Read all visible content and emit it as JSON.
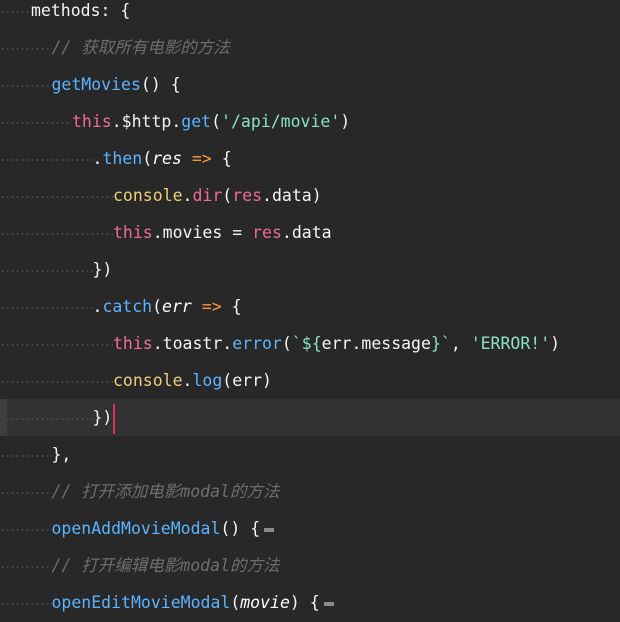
{
  "editor": {
    "lines": [
      {
        "indent": 0,
        "tokens": [
          {
            "t": "methods",
            "c": "k-white"
          },
          {
            "t": ": {",
            "c": "k-op"
          }
        ]
      },
      {
        "indent": 1,
        "tokens": [
          {
            "t": "// 获取所有电影的方法",
            "c": "k-comment"
          }
        ]
      },
      {
        "indent": 1,
        "tokens": [
          {
            "t": "getMovies",
            "c": "k-fn"
          },
          {
            "t": "() {",
            "c": "k-op"
          }
        ]
      },
      {
        "indent": 2,
        "tokens": [
          {
            "t": "this",
            "c": "k-kw"
          },
          {
            "t": ".$http.",
            "c": "k-op"
          },
          {
            "t": "get",
            "c": "k-fn"
          },
          {
            "t": "(",
            "c": "k-op"
          },
          {
            "t": "'/api/movie'",
            "c": "k-str"
          },
          {
            "t": ")",
            "c": "k-op"
          }
        ]
      },
      {
        "indent": 3,
        "tokens": [
          {
            "t": ".",
            "c": "k-op"
          },
          {
            "t": "then",
            "c": "k-fn"
          },
          {
            "t": "(",
            "c": "k-op"
          },
          {
            "t": "res",
            "c": "k-param"
          },
          {
            "t": " => ",
            "c": "k-arrow"
          },
          {
            "t": "{",
            "c": "k-op"
          }
        ]
      },
      {
        "indent": 4,
        "tokens": [
          {
            "t": "console",
            "c": "k-var"
          },
          {
            "t": ".",
            "c": "k-op"
          },
          {
            "t": "dir",
            "c": "k-kw"
          },
          {
            "t": "(",
            "c": "k-op"
          },
          {
            "t": "res",
            "c": "k-kw"
          },
          {
            "t": ".data)",
            "c": "k-op"
          }
        ]
      },
      {
        "indent": 4,
        "tokens": [
          {
            "t": "this",
            "c": "k-kw"
          },
          {
            "t": ".movies = ",
            "c": "k-op"
          },
          {
            "t": "res",
            "c": "k-kw"
          },
          {
            "t": ".data",
            "c": "k-op"
          }
        ]
      },
      {
        "indent": 3,
        "tokens": [
          {
            "t": "})",
            "c": "k-op"
          }
        ]
      },
      {
        "indent": 3,
        "tokens": [
          {
            "t": ".",
            "c": "k-op"
          },
          {
            "t": "catch",
            "c": "k-fn"
          },
          {
            "t": "(",
            "c": "k-op"
          },
          {
            "t": "err",
            "c": "k-param"
          },
          {
            "t": " => ",
            "c": "k-arrow"
          },
          {
            "t": "{",
            "c": "k-op"
          }
        ]
      },
      {
        "indent": 4,
        "tokens": [
          {
            "t": "this",
            "c": "k-kw"
          },
          {
            "t": ".toastr.",
            "c": "k-op"
          },
          {
            "t": "error",
            "c": "k-fn"
          },
          {
            "t": "(",
            "c": "k-op"
          },
          {
            "t": "`${",
            "c": "k-str"
          },
          {
            "t": "err.message",
            "c": "k-op"
          },
          {
            "t": "}`",
            "c": "k-str"
          },
          {
            "t": ", ",
            "c": "k-op"
          },
          {
            "t": "'ERROR!'",
            "c": "k-str"
          },
          {
            "t": ")",
            "c": "k-op"
          }
        ]
      },
      {
        "indent": 4,
        "tokens": [
          {
            "t": "console",
            "c": "k-var"
          },
          {
            "t": ".",
            "c": "k-op"
          },
          {
            "t": "log",
            "c": "k-fn"
          },
          {
            "t": "(err)",
            "c": "k-op"
          }
        ]
      },
      {
        "indent": 3,
        "active": true,
        "cursor": true,
        "tokens": [
          {
            "t": "})",
            "c": "k-op"
          }
        ]
      },
      {
        "indent": 1,
        "tokens": [
          {
            "t": "},",
            "c": "k-op"
          }
        ]
      },
      {
        "indent": 1,
        "tokens": [
          {
            "t": "// 打开添加电影modal的方法",
            "c": "k-comment"
          }
        ]
      },
      {
        "indent": 1,
        "fold": true,
        "tokens": [
          {
            "t": "openAddMovieModal",
            "c": "k-fn"
          },
          {
            "t": "() {",
            "c": "k-op"
          }
        ]
      },
      {
        "indent": 1,
        "tokens": [
          {
            "t": "// 打开编辑电影modal的方法",
            "c": "k-comment"
          }
        ]
      },
      {
        "indent": 1,
        "fold": true,
        "tokens": [
          {
            "t": "openEditMovieModal",
            "c": "k-fn"
          },
          {
            "t": "(",
            "c": "k-op"
          },
          {
            "t": "movie",
            "c": "k-param"
          },
          {
            "t": ") {",
            "c": "k-op"
          }
        ]
      }
    ]
  }
}
